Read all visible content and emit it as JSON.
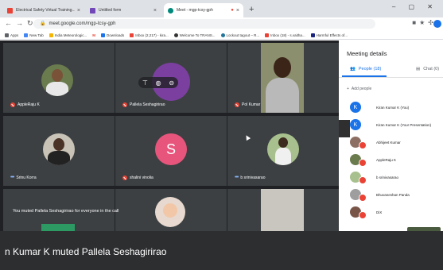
{
  "browser": {
    "tabs": [
      {
        "title": "Electrical Safety Virtual Training...",
        "color": "#ea4335"
      },
      {
        "title": "Untitled form",
        "color": "#7248b9"
      },
      {
        "title": "Meet - mgp-tcsy-gph",
        "color": "#00897b"
      }
    ],
    "new_tab": "+",
    "window_controls": "–  ▢  ✕",
    "url": "meet.google.com/mgp-tcsy-gph",
    "bookmarks": [
      {
        "label": "Apps",
        "color": "#5f6368"
      },
      {
        "label": "New Tab",
        "color": "#4285f4"
      },
      {
        "label": "India Meteorologic...",
        "color": "#f4b400"
      },
      {
        "label": "M",
        "color": "#ea4335"
      },
      {
        "label": "Downloads",
        "color": "#1a73e8"
      },
      {
        "label": "Inbox (2,217) - kira...",
        "color": "#ea4335"
      },
      {
        "label": "Welcome To TRANS...",
        "color": "#333333"
      },
      {
        "label": "Lockout tagout – R...",
        "color": "#21759b"
      },
      {
        "label": "Inbox (18) - s.vaitha...",
        "color": "#ea4335"
      },
      {
        "label": "Harmful Effects of...",
        "color": "#1a237e"
      }
    ]
  },
  "tiles": {
    "applerajuk": "AppleRaju K",
    "pallela": "Pallela Seshagirirao",
    "pol": "Pol Kumar",
    "srinu": "Srinu Korra",
    "shalini": "shalini vinolia",
    "srinivasarao": "b srinivasarao"
  },
  "shalini_initial": "S",
  "toast": "You muted Pallela Seshagirirao for everyone in the call",
  "panel": {
    "title": "Meeting details",
    "tab_people": "People (18)",
    "tab_chat": "Chat (0)",
    "add_people": "Add people",
    "participants": [
      {
        "name": "Kiran Kumar K (You)"
      },
      {
        "name": "Kiran Kumar K (Your Presentation)"
      },
      {
        "name": "Abhijeet Kumar"
      },
      {
        "name": "AppleRaju K"
      },
      {
        "name": "b srinivasarao"
      },
      {
        "name": "Bhuvaneshan Panda"
      },
      {
        "name": "DiX"
      }
    ]
  },
  "caption": "n Kumar K muted Pallela Seshagirirao"
}
